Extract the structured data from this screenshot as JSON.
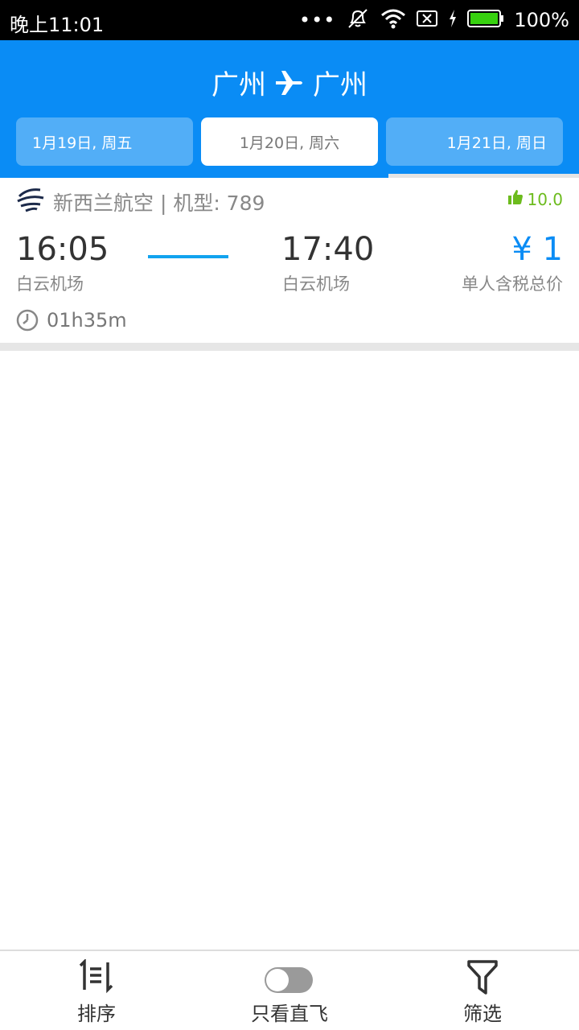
{
  "status_bar": {
    "time": "晚上11:01",
    "dots": "•••",
    "battery_text": "100%",
    "icons": [
      "mute-icon",
      "wifi-icon",
      "no-sim-icon",
      "charging-icon",
      "battery-icon"
    ],
    "battery_color": "#37d10f"
  },
  "header": {
    "origin": "广州",
    "destination": "广州",
    "route_icon": "airplane-icon",
    "accent": "#0a8cf5"
  },
  "date_tabs": [
    {
      "label": "1月19日, 周五",
      "selected": false
    },
    {
      "label": "1月20日, 周六",
      "selected": true
    },
    {
      "label": "1月21日, 周日",
      "selected": false
    }
  ],
  "flight": {
    "airline_text": "新西兰航空 | 机型: 789",
    "airline_logo": "air-new-zealand-logo",
    "rating": "10.0",
    "rating_icon": "thumbs-up-icon",
    "rating_color": "#6cbb1d",
    "departure_time": "16:05",
    "departure_airport": "白云机场",
    "arrival_time": "17:40",
    "arrival_airport": "白云机场",
    "price": "¥ 1",
    "price_label": "单人含税总价",
    "duration": "01h35m",
    "duration_icon": "clock-icon"
  },
  "bottom_bar": {
    "sort_label": "排序",
    "sort_icon": "sort-icon",
    "direct_label": "只看直飞",
    "direct_toggle_on": false,
    "filter_label": "筛选",
    "filter_icon": "filter-funnel-icon"
  }
}
